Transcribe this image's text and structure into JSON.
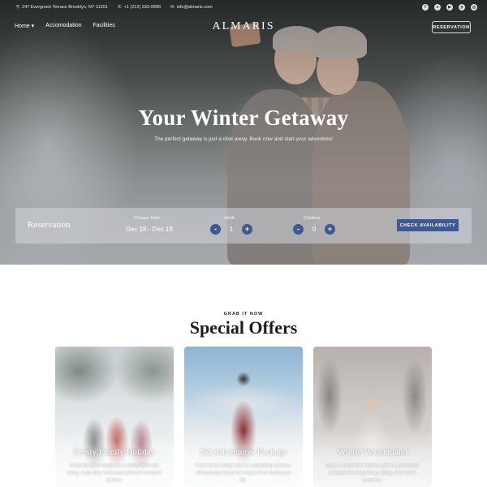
{
  "topbar": {
    "address": "247 Evergreen Terrace Brooklyn, NY 11201",
    "phone": "+1 (212) 333-9996",
    "email": "info@almaris.com",
    "social": [
      "facebook-icon",
      "x-icon",
      "youtube-icon",
      "pinterest-icon",
      "instagram-icon"
    ]
  },
  "nav": {
    "links": [
      "Home",
      "Accomodation",
      "Facilities"
    ],
    "home_arrow": "▾",
    "logo": "ALMARIS",
    "reservation_button": "RESERVATION"
  },
  "hero": {
    "title": "Your Winter Getaway",
    "subtitle": "The perfect getaway is just a click away. Book now and start your adventure!"
  },
  "reservation": {
    "title": "Reservation",
    "date_label": "Choose Date",
    "date_value": "Dec 18 - Dec 19",
    "adult_label": "Adult",
    "adult_value": "1",
    "children_label": "Children",
    "children_value": "0",
    "minus": "-",
    "plus": "+",
    "check_button": "CHECK AVAILABILITY"
  },
  "offers": {
    "eyebrow": "GRAB IT NOW",
    "title": "Special Offers",
    "cards": [
      {
        "title": "Frosty Family Holiday",
        "desc": "Bring the whole family for a holiday filled with skiing, snow play, and seasonal treats everyone will love."
      },
      {
        "title": "Ski Adventures Package",
        "desc": "From scenic sleigh rides to exhilarating ski trails, this package brings the magic of the holidays to life."
      },
      {
        "title": "Winter Wonderland",
        "desc": "Enjoy a hassle-free holiday with an all-inclusive package featuring skiing, dining, and festive surprises."
      }
    ]
  },
  "colors": {
    "accent": "#3e5a91"
  }
}
